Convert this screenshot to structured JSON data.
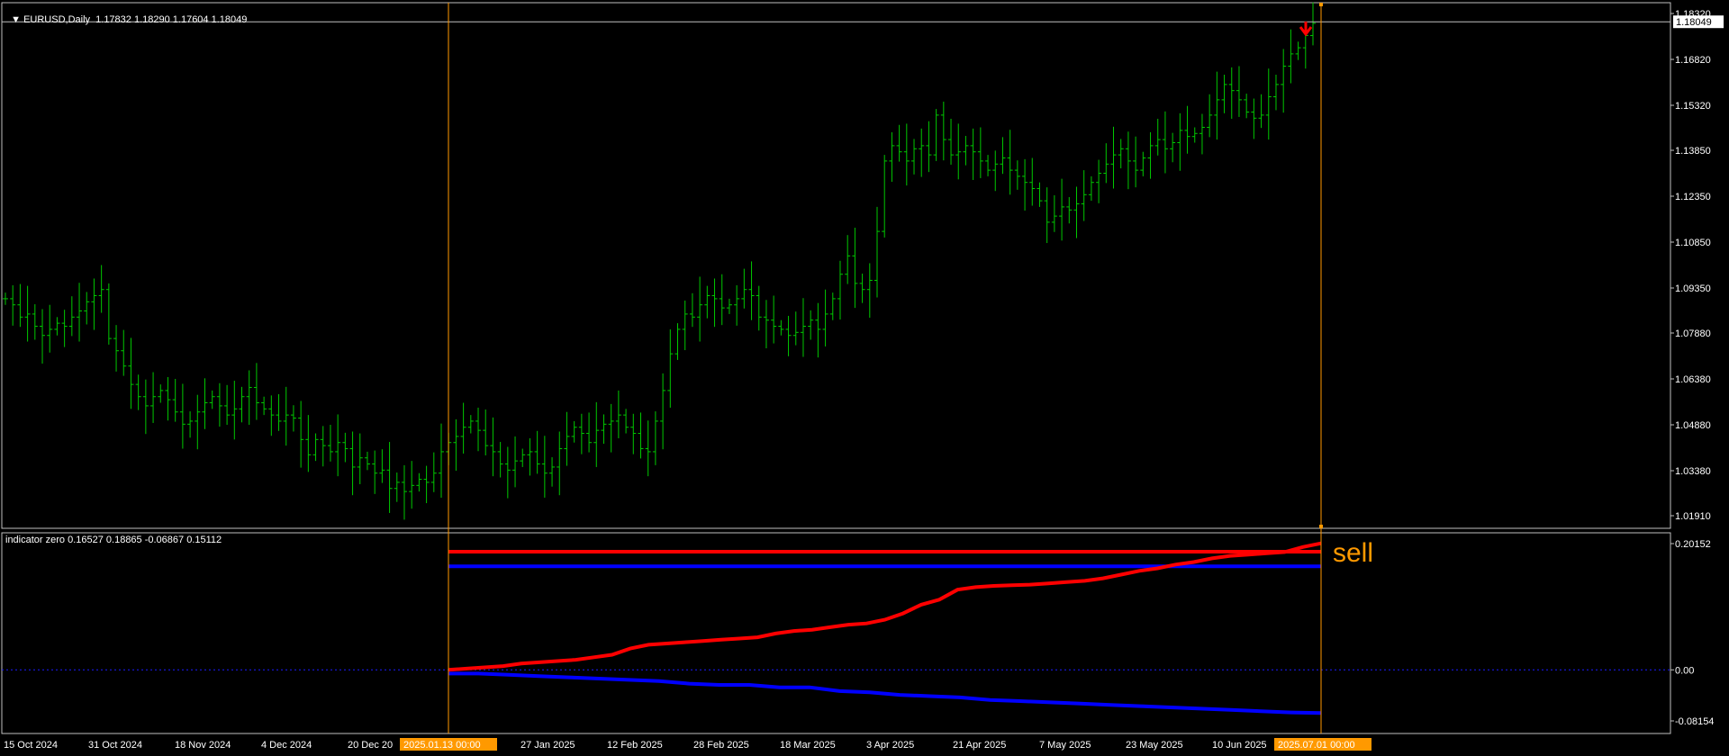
{
  "symbol_header": "EURUSD,Daily  1.17832 1.18290 1.17604 1.18049",
  "indicator_header": "indicator zero 0.16527 0.18865 -0.06867 0.15112",
  "price_axis": {
    "labels": [
      "1.18320",
      "1.16820",
      "1.15320",
      "1.13850",
      "1.12350",
      "1.10850",
      "1.09350",
      "1.07880",
      "1.06380",
      "1.04880",
      "1.03380",
      "1.01910"
    ],
    "current_price": "1.18049"
  },
  "indicator_axis": {
    "labels": [
      "0.20152",
      "0.00",
      "-0.08154"
    ]
  },
  "time_axis": {
    "labels": [
      "15 Oct 2024",
      "31 Oct 2024",
      "18 Nov 2024",
      "4 Dec 2024",
      "20 Dec 20",
      "27 Jan 2025",
      "12 Feb 2025",
      "28 Feb 2025",
      "18 Mar 2025",
      "3 Apr 2025",
      "21 Apr 2025",
      "7 May 2025",
      "23 May 2025",
      "10 Jun 2025"
    ],
    "highlight_start": "2025.01.13 00:00",
    "highlight_end": "2025.07.01 00:00"
  },
  "signal_label": "sell",
  "colors": {
    "background": "#000000",
    "bars": "#00c800",
    "grid_border": "#c0c0c0",
    "vertical_marker": "#ff9900",
    "arrow": "#ff0000",
    "indicator_red": "#ff0000",
    "indicator_blue": "#0000ff",
    "zero_line": "#1a1aff"
  },
  "chart_data": [
    {
      "type": "ohlc",
      "symbol": "EURUSD",
      "timeframe": "Daily",
      "last_bar": {
        "open": 1.17832,
        "high": 1.1829,
        "low": 1.17604,
        "close": 1.18049
      },
      "ylim": [
        1.0191,
        1.1832
      ],
      "close_series_approx": [
        1.09,
        1.088,
        1.084,
        1.085,
        1.081,
        1.078,
        1.08,
        1.082,
        1.081,
        1.084,
        1.086,
        1.089,
        1.091,
        1.093,
        1.077,
        1.073,
        1.068,
        1.062,
        1.058,
        1.055,
        1.058,
        1.06,
        1.057,
        1.053,
        1.049,
        1.05,
        1.053,
        1.056,
        1.058,
        1.055,
        1.052,
        1.054,
        1.058,
        1.061,
        1.056,
        1.054,
        1.052,
        1.05,
        1.052,
        1.051,
        1.044,
        1.039,
        1.044,
        1.042,
        1.04,
        1.043,
        1.041,
        1.035,
        1.038,
        1.036,
        1.033,
        1.034,
        1.028,
        1.03,
        1.027,
        1.029,
        1.031,
        1.03,
        1.033,
        1.04,
        1.043,
        1.045,
        1.048,
        1.05,
        1.047,
        1.042,
        1.04,
        1.036,
        1.034,
        1.037,
        1.039,
        1.04,
        1.036,
        1.033,
        1.035,
        1.041,
        1.045,
        1.048,
        1.046,
        1.043,
        1.047,
        1.049,
        1.05,
        1.052,
        1.048,
        1.046,
        1.041,
        1.04,
        1.05,
        1.06,
        1.072,
        1.08,
        1.085,
        1.084,
        1.088,
        1.091,
        1.09,
        1.087,
        1.088,
        1.09,
        1.093,
        1.091,
        1.084,
        1.083,
        1.081,
        1.08,
        1.078,
        1.079,
        1.081,
        1.083,
        1.08,
        1.085,
        1.09,
        1.098,
        1.104,
        1.095,
        1.093,
        1.096,
        1.112,
        1.135,
        1.14,
        1.138,
        1.135,
        1.139,
        1.14,
        1.137,
        1.15,
        1.142,
        1.137,
        1.138,
        1.14,
        1.138,
        1.135,
        1.132,
        1.134,
        1.136,
        1.132,
        1.13,
        1.128,
        1.126,
        1.122,
        1.115,
        1.117,
        1.12,
        1.119,
        1.121,
        1.124,
        1.128,
        1.131,
        1.134,
        1.137,
        1.139,
        1.135,
        1.132,
        1.136,
        1.14,
        1.142,
        1.139,
        1.141,
        1.145,
        1.143,
        1.144,
        1.146,
        1.15,
        1.155,
        1.16,
        1.158,
        1.155,
        1.151,
        1.149,
        1.15,
        1.156,
        1.16,
        1.166,
        1.17,
        1.172,
        1.176,
        1.18
      ]
    },
    {
      "type": "line",
      "title": "indicator zero",
      "ylim": [
        -0.08154,
        0.20152
      ],
      "values_header": [
        0.16527,
        0.18865,
        -0.06867,
        0.15112
      ],
      "series": [
        {
          "color": "#ff0000",
          "kind": "flat",
          "value": 0.18865
        },
        {
          "color": "#0000ff",
          "kind": "flat",
          "value": 0.16527
        },
        {
          "color": "#ff0000",
          "kind": "curve",
          "values": [
            0.0,
            0.002,
            0.004,
            0.006,
            0.01,
            0.012,
            0.014,
            0.016,
            0.02,
            0.024,
            0.034,
            0.04,
            0.042,
            0.044,
            0.046,
            0.048,
            0.05,
            0.052,
            0.058,
            0.062,
            0.064,
            0.068,
            0.072,
            0.074,
            0.08,
            0.09,
            0.104,
            0.112,
            0.128,
            0.132,
            0.134,
            0.135,
            0.136,
            0.138,
            0.14,
            0.142,
            0.146,
            0.152,
            0.158,
            0.162,
            0.168,
            0.172,
            0.178,
            0.182,
            0.184,
            0.186,
            0.188,
            0.196,
            0.202
          ]
        },
        {
          "color": "#0000ff",
          "kind": "curve",
          "values": [
            -0.006,
            -0.006,
            -0.008,
            -0.01,
            -0.012,
            -0.014,
            -0.016,
            -0.018,
            -0.022,
            -0.024,
            -0.024,
            -0.028,
            -0.028,
            -0.034,
            -0.036,
            -0.04,
            -0.042,
            -0.044,
            -0.048,
            -0.05,
            -0.052,
            -0.054,
            -0.056,
            -0.058,
            -0.06,
            -0.062,
            -0.064,
            -0.066,
            -0.068,
            -0.069
          ]
        }
      ]
    }
  ]
}
